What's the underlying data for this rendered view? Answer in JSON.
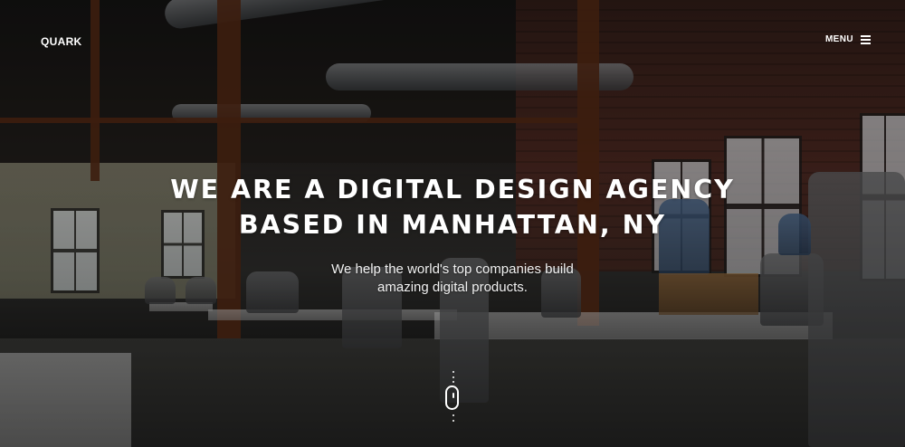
{
  "header": {
    "logo": "QUARK",
    "menu_label": "MENU",
    "menu_icon": "hamburger-icon"
  },
  "hero": {
    "title_line1": "WE ARE A DIGITAL DESIGN AGENCY",
    "title_line2": "BASED IN MANHATTAN, NY",
    "subtitle_line1": "We help the world's top companies build",
    "subtitle_line2": "amazing digital products."
  },
  "scroll_indicator": {
    "icon": "mouse-scroll-icon"
  },
  "colors": {
    "text": "#ffffff",
    "overlay": "#000000"
  }
}
